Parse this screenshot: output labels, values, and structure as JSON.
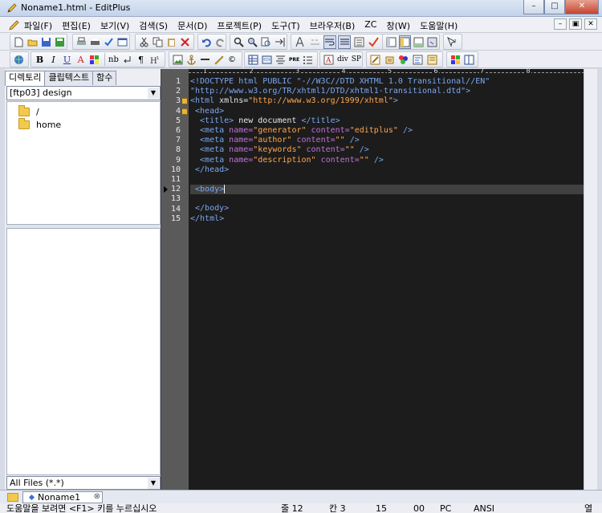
{
  "window": {
    "title": "Noname1.html - EditPlus"
  },
  "menu": {
    "items": [
      "파일(F)",
      "편집(E)",
      "보기(V)",
      "검색(S)",
      "문서(D)",
      "프로젝트(P)",
      "도구(T)",
      "브라우저(B)",
      "ZC",
      "창(W)",
      "도움말(H)"
    ]
  },
  "toolbar2": {
    "b": "B",
    "i": "I",
    "u": "U",
    "a": "A",
    "nb": "nb",
    "pre": "PRE",
    "div": "div",
    "sp": "SP"
  },
  "sidebar": {
    "tabs": [
      "디렉토리",
      "클립텍스트",
      "함수"
    ],
    "directory": "[ftp03] design",
    "folders": [
      "/",
      "home"
    ],
    "filter": "All Files (*.*)"
  },
  "ruler": {
    "marks": [
      "1",
      "2",
      "3",
      "4",
      "5",
      "6",
      "7",
      "8"
    ]
  },
  "editor": {
    "line_numbers": [
      "1",
      "2",
      "3",
      "4",
      "5",
      "6",
      "7",
      "8",
      "9",
      "10",
      "11",
      "12",
      "13",
      "14",
      "15"
    ],
    "lines": [
      [
        [
          "tg",
          "<!DOCTYPE html PUBLIC \"-//W3C//DTD XHTML 1.0 Transitional//EN\""
        ]
      ],
      [
        [
          "tg",
          "\"http://www.w3.org/TR/xhtml1/DTD/xhtml1-transitional.dtd\">"
        ]
      ],
      [
        [
          "tg",
          "<html "
        ],
        [
          "tx",
          "xmlns="
        ],
        [
          "vl",
          "\"http://www.w3.org/1999/xhtml\""
        ],
        [
          "tg",
          ">"
        ]
      ],
      [
        [
          "tg",
          " <head>"
        ]
      ],
      [
        [
          "tg",
          "  <title>"
        ],
        [
          "tx",
          " new document "
        ],
        [
          "tg",
          "</title>"
        ]
      ],
      [
        [
          "tg",
          "  <meta "
        ],
        [
          "at",
          "name="
        ],
        [
          "vl",
          "\"generator\""
        ],
        [
          "at",
          " content="
        ],
        [
          "vl",
          "\"editplus\""
        ],
        [
          "tg",
          " />"
        ]
      ],
      [
        [
          "tg",
          "  <meta "
        ],
        [
          "at",
          "name="
        ],
        [
          "vl",
          "\"author\""
        ],
        [
          "at",
          " content="
        ],
        [
          "vl",
          "\"\""
        ],
        [
          "tg",
          " />"
        ]
      ],
      [
        [
          "tg",
          "  <meta "
        ],
        [
          "at",
          "name="
        ],
        [
          "vl",
          "\"keywords\""
        ],
        [
          "at",
          " content="
        ],
        [
          "vl",
          "\"\""
        ],
        [
          "tg",
          " />"
        ]
      ],
      [
        [
          "tg",
          "  <meta "
        ],
        [
          "at",
          "name="
        ],
        [
          "vl",
          "\"description\""
        ],
        [
          "at",
          " content="
        ],
        [
          "vl",
          "\"\""
        ],
        [
          "tg",
          " />"
        ]
      ],
      [
        [
          "tg",
          " </head>"
        ]
      ],
      [
        [
          "tx",
          ""
        ]
      ],
      [
        [
          "tg",
          " <body>"
        ]
      ],
      [
        [
          "tx",
          "  "
        ]
      ],
      [
        [
          "tg",
          " </body>"
        ]
      ],
      [
        [
          "tg",
          "</html>"
        ]
      ]
    ]
  },
  "documents": [
    {
      "name": "Noname1"
    }
  ],
  "status": {
    "help": "도움말을 보려면 <F1> 키를 누르십시오",
    "line": "줄 12",
    "col": "칸 3",
    "count": "15",
    "ins": "00",
    "eol": "PC",
    "encoding": "ANSI",
    "extra": "열"
  },
  "colors": {
    "tag": "#7aa7f0",
    "attribute": "#c071d6",
    "value": "#ffa64d",
    "background": "#1c1c1c"
  }
}
